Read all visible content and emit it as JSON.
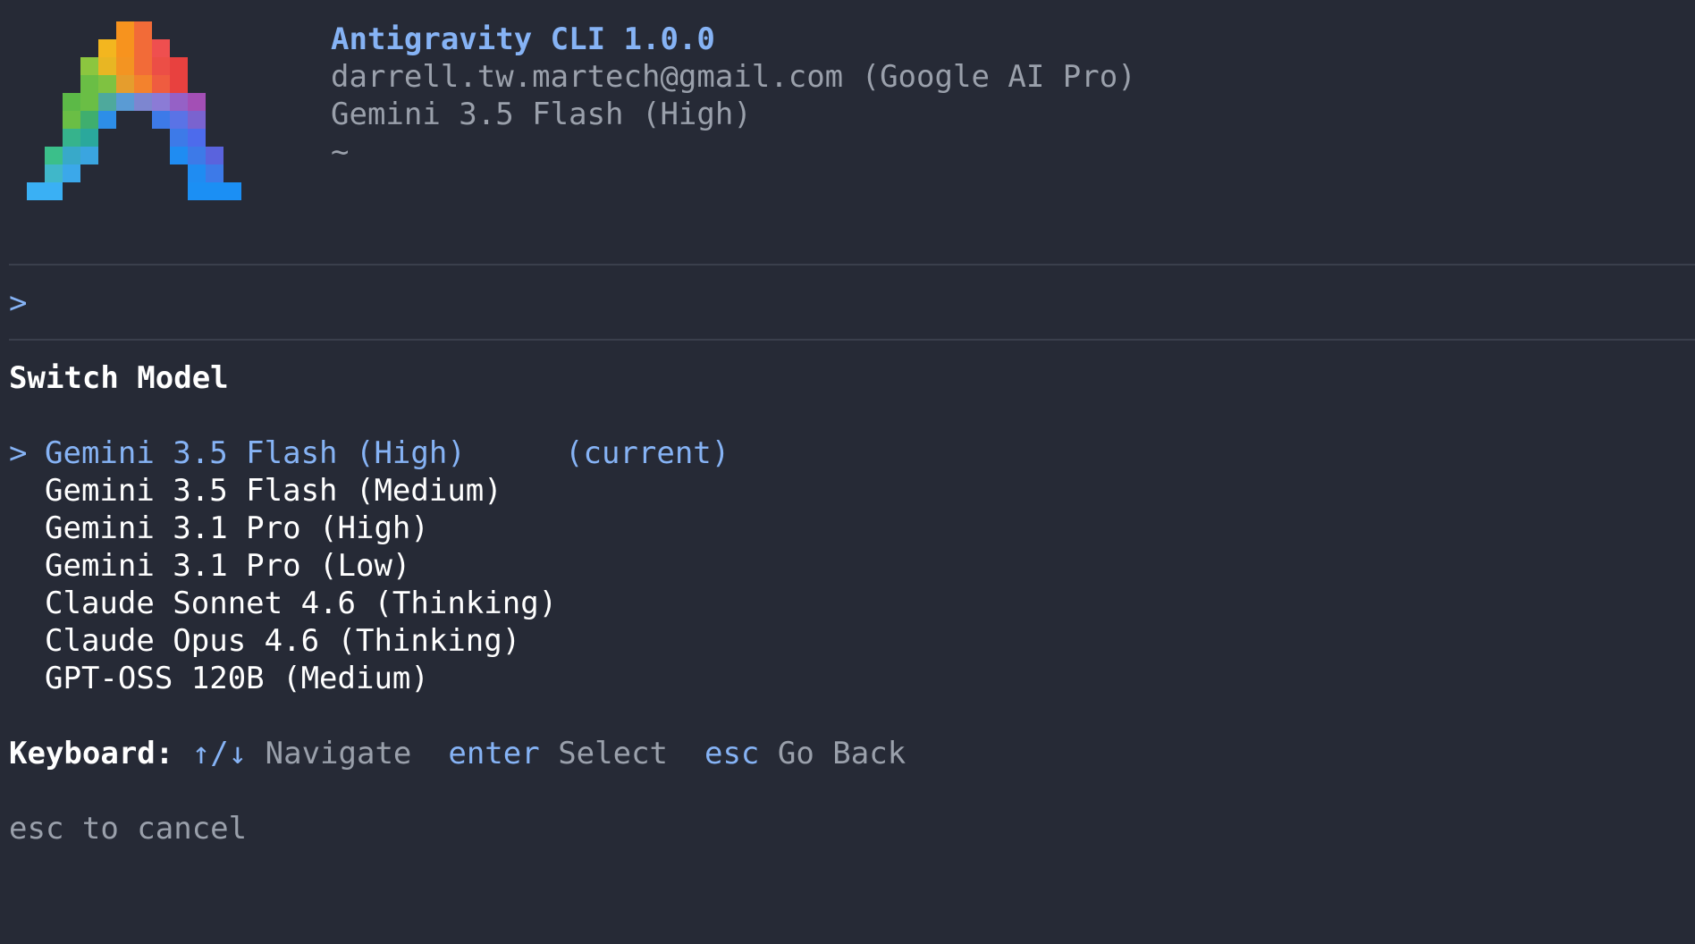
{
  "header": {
    "title": "Antigravity CLI 1.0.0",
    "account": "darrell.tw.martech@gmail.com (Google AI Pro)",
    "model": "Gemini 3.5 Flash (High)",
    "cwd": "~"
  },
  "prompt": {
    "symbol": ">",
    "value": ""
  },
  "menu": {
    "title": "Switch Model",
    "selected_marker": ">",
    "current_tag": "(current)",
    "items": [
      {
        "label": "Gemini 3.5 Flash (High)",
        "selected": true,
        "current": true
      },
      {
        "label": "Gemini 3.5 Flash (Medium)",
        "selected": false,
        "current": false
      },
      {
        "label": "Gemini 3.1 Pro (High)",
        "selected": false,
        "current": false
      },
      {
        "label": "Gemini 3.1 Pro (Low)",
        "selected": false,
        "current": false
      },
      {
        "label": "Claude Sonnet 4.6 (Thinking)",
        "selected": false,
        "current": false
      },
      {
        "label": "Claude Opus 4.6 (Thinking)",
        "selected": false,
        "current": false
      },
      {
        "label": "GPT-OSS 120B (Medium)",
        "selected": false,
        "current": false
      }
    ]
  },
  "keyboard": {
    "label": "Keyboard:",
    "nav_keys": "↑/↓",
    "nav_action": "Navigate",
    "select_key": "enter",
    "select_action": "Select",
    "back_key": "esc",
    "back_action": "Go Back"
  },
  "footer": {
    "hint": "esc to cancel"
  },
  "colors": {
    "background": "#262a36",
    "accent": "#86b3f5",
    "dim_text": "#9aa0ab",
    "text": "#ffffff",
    "divider": "#3a3f4c"
  },
  "logo": {
    "name": "antigravity-logo"
  }
}
